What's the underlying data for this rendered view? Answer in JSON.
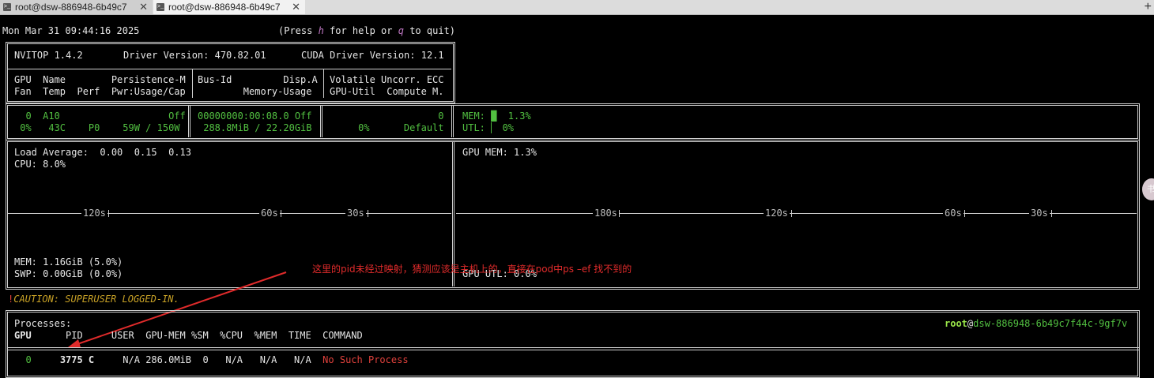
{
  "tabs": [
    {
      "label": "root@dsw-886948-6b49c7",
      "active": false
    },
    {
      "label": "root@dsw-886948-6b49c7",
      "active": true
    }
  ],
  "tab_close_glyph": "✕",
  "new_tab_glyph": "+",
  "header": {
    "datetime": "Mon Mar 31 09:44:16 2025",
    "help_open": "(Press ",
    "help_key": "h",
    "help_mid": " for help or ",
    "quit_key": "q",
    "help_close": " to quit)"
  },
  "driver_box": {
    "nvitop": "NVITOP 1.4.2",
    "driver": "Driver Version: 470.82.01",
    "cuda": "CUDA Driver Version: 12.1"
  },
  "gpu_header": {
    "c1_l1": "GPU  Name        Persistence-M",
    "c1_l2": "Fan  Temp  Perf  Pwr:Usage/Cap",
    "c2_l1": "Bus-Id         Disp.A",
    "c2_l2": "        Memory-Usage",
    "c3_l1": "Volatile Uncorr. ECC",
    "c3_l2": "GPU-Util  Compute M."
  },
  "gpu_row": {
    "c1_l1": "  0  A10                   Off",
    "c1_l2": " 0%   43C    P0    59W / 150W",
    "c2_l1": "00000000:00:08.0 Off",
    "c2_l2": " 288.8MiB / 22.20GiB",
    "c3_l1": "                   0",
    "c3_l2": "     0%      Default",
    "mem_label": "MEM: ",
    "mem_bar_glyph": "█",
    "mem_value": "  1.3%",
    "utl_label": "UTL: ",
    "utl_bar_glyph": "▏",
    "utl_value": " 0%",
    "mem_fraction": 0.013,
    "utl_fraction": 0.0
  },
  "host_panel": {
    "load_avg": "Load Average:  0.00  0.15  0.13",
    "cpu": "CPU: 8.0%",
    "mem": "MEM: 1.16GiB (5.0%)",
    "swp": "SWP: 0.00GiB (0.0%)",
    "ticks": [
      "120s",
      "60s",
      "30s"
    ]
  },
  "gpu_panel": {
    "gpu_mem": "GPU MEM: 1.3%",
    "gpu_utl": "GPU UTL: 0.0%",
    "ticks": [
      "180s",
      "120s",
      "60s",
      "30s"
    ]
  },
  "annotation": "这里的pid未经过映射，猜测应该是主机上的，直接在pod中ps –ef 找不到的",
  "caution": {
    "bang": "!",
    "text": "CAUTION: SUPERUSER LOGGED-IN."
  },
  "processes": {
    "title": "Processes:",
    "user_name": "root",
    "at": "@",
    "host": "dsw-886948-6b49c7f44c-9gf7v",
    "columns": {
      "gpu": "GPU",
      "pid": "PID",
      "rest": "USER  GPU-MEM %SM  %CPU  %MEM  TIME  COMMAND"
    },
    "rows": [
      {
        "gpu": "0",
        "pid": "3775 C",
        "rest": "N/A 286.0MiB  0   N/A   N/A   N/A  ",
        "command": "No Such Process"
      }
    ]
  },
  "scroll_glyph": "书",
  "colors": {
    "background": "#000000",
    "text": "#e6e6e6",
    "green": "#52c041",
    "caution_yellow": "#c9a226",
    "error_red": "#e0413c",
    "key_purple": "#c078c4",
    "annotation_red": "#e02b2b"
  }
}
